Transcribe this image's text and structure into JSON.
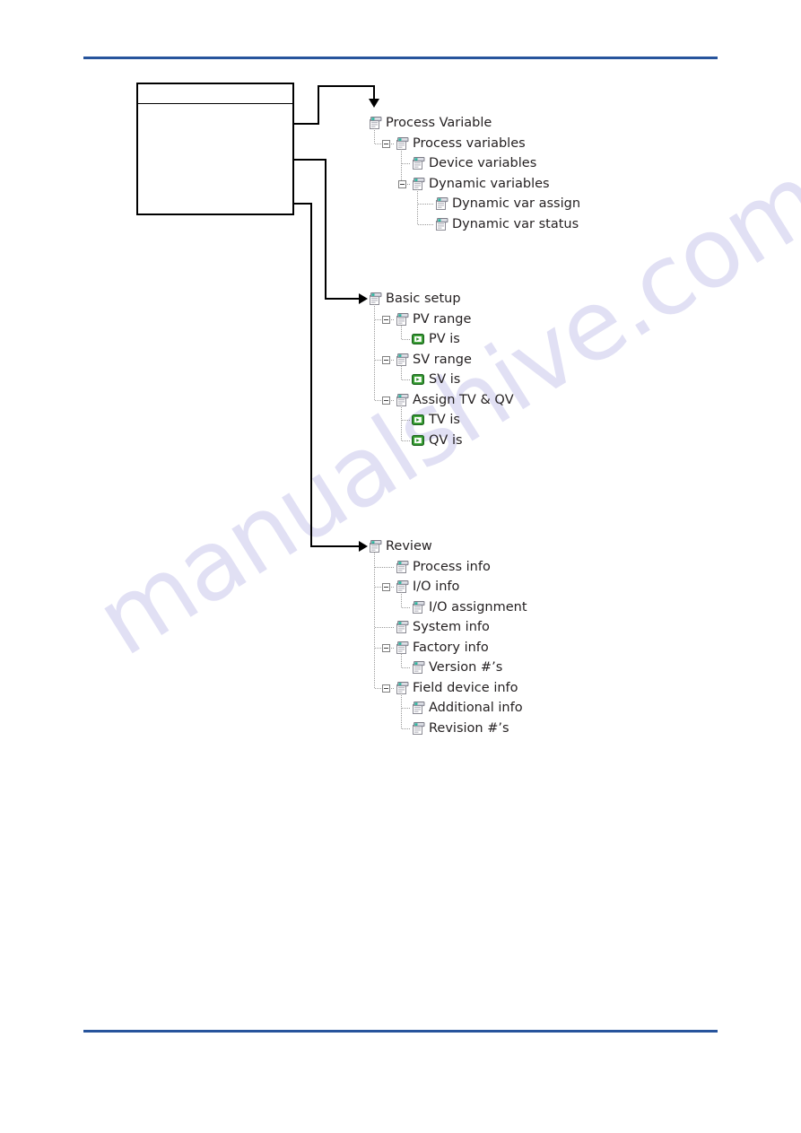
{
  "document": {
    "watermark": "manualshive.com",
    "rule_color": "#27549c"
  },
  "reference_box": {
    "header_text": "",
    "body_text": ""
  },
  "connectors": [
    {
      "name": "box-to-process-variable",
      "arrow": "down"
    },
    {
      "name": "box-to-basic-setup",
      "arrow": "right"
    },
    {
      "name": "box-to-review",
      "arrow": "right"
    }
  ],
  "trees": [
    {
      "id": "process-variable",
      "root": "Process Variable",
      "rows": [
        {
          "label": "Process Variable",
          "level": 0,
          "icon": "menu-icon",
          "expander": false
        },
        {
          "label": "Process variables",
          "level": 1,
          "icon": "menu-icon",
          "expander": true
        },
        {
          "label": "Device variables",
          "level": 2,
          "icon": "menu-icon",
          "expander": false
        },
        {
          "label": "Dynamic variables",
          "level": 2,
          "icon": "menu-icon",
          "expander": true
        },
        {
          "label": "Dynamic var assign",
          "level": 3,
          "icon": "menu-icon",
          "expander": false
        },
        {
          "label": "Dynamic var status",
          "level": 3,
          "icon": "menu-icon",
          "expander": false
        }
      ]
    },
    {
      "id": "basic-setup",
      "root": "Basic setup",
      "rows": [
        {
          "label": "Basic setup",
          "level": 0,
          "icon": "menu-icon",
          "expander": false
        },
        {
          "label": "PV range",
          "level": 1,
          "icon": "menu-icon",
          "expander": true
        },
        {
          "label": "PV is",
          "level": 2,
          "icon": "method-icon",
          "expander": false
        },
        {
          "label": "SV range",
          "level": 1,
          "icon": "menu-icon",
          "expander": true
        },
        {
          "label": "SV is",
          "level": 2,
          "icon": "method-icon",
          "expander": false
        },
        {
          "label": "Assign TV & QV",
          "level": 1,
          "icon": "menu-icon",
          "expander": true
        },
        {
          "label": "TV is",
          "level": 2,
          "icon": "method-icon",
          "expander": false
        },
        {
          "label": "QV is",
          "level": 2,
          "icon": "method-icon",
          "expander": false
        }
      ]
    },
    {
      "id": "review",
      "root": "Review",
      "rows": [
        {
          "label": "Review",
          "level": 0,
          "icon": "menu-icon",
          "expander": false
        },
        {
          "label": "Process info",
          "level": 1,
          "icon": "menu-icon",
          "expander": false
        },
        {
          "label": "I/O info",
          "level": 1,
          "icon": "menu-icon",
          "expander": true
        },
        {
          "label": "I/O assignment",
          "level": 2,
          "icon": "menu-icon",
          "expander": false
        },
        {
          "label": "System info",
          "level": 1,
          "icon": "menu-icon",
          "expander": false
        },
        {
          "label": "Factory info",
          "level": 1,
          "icon": "menu-icon",
          "expander": true
        },
        {
          "label": "Version #’s",
          "level": 2,
          "icon": "menu-icon",
          "expander": false
        },
        {
          "label": "Field device info",
          "level": 1,
          "icon": "menu-icon",
          "expander": true
        },
        {
          "label": "Additional info",
          "level": 2,
          "icon": "menu-icon",
          "expander": false
        },
        {
          "label": "Revision #’s",
          "level": 2,
          "icon": "menu-icon",
          "expander": false
        }
      ]
    }
  ]
}
